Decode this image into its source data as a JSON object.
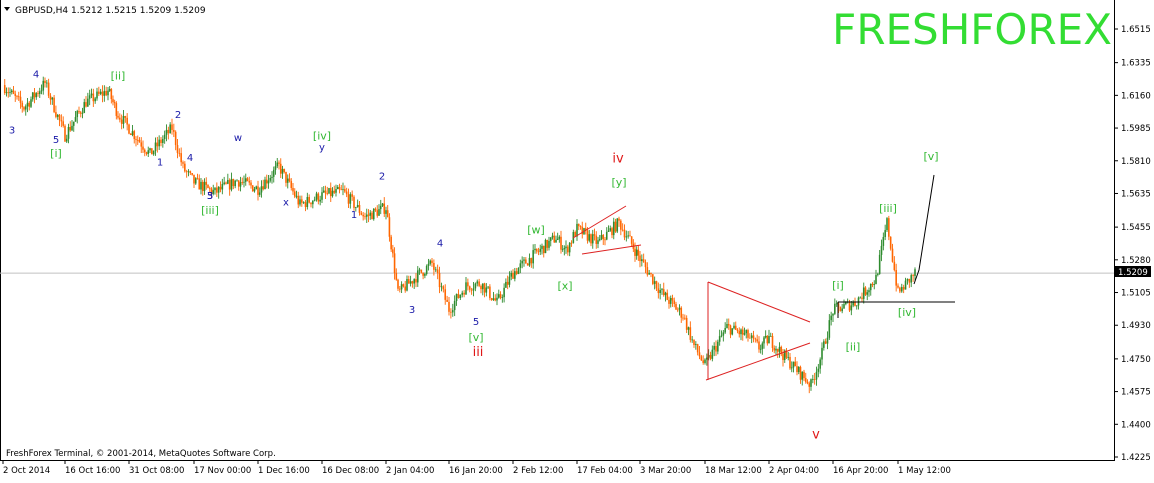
{
  "header": {
    "symbol_text": "GBPUSD,H4  1.5212 1.5215 1.5209 1.5209"
  },
  "watermark": {
    "text": "FRESHFOREX",
    "color": "#33dd33"
  },
  "footer": {
    "copyright": "FreshForex Terminal, © 2001-2014, MetaQuotes Software Corp."
  },
  "colors": {
    "candle_up": "#2e8b2e",
    "candle_down": "#ff6600",
    "trendline_red": "#dd2222",
    "projection_black": "#000000",
    "wave_blue": "#1a1aa8",
    "wave_green": "#33b833",
    "wave_red": "#e01818"
  },
  "chart_data": {
    "type": "line",
    "title": "GBPUSD,H4",
    "ohlc_header": {
      "open": 1.5212,
      "high": 1.5215,
      "low": 1.5209,
      "close": 1.5209
    },
    "current_price": "1.5209",
    "ylim": [
      1.4225,
      1.6615
    ],
    "y_ticks": [
      "1.6515",
      "1.6335",
      "1.6160",
      "1.5985",
      "1.5810",
      "1.5635",
      "1.5455",
      "1.5280",
      "1.5105",
      "1.4930",
      "1.4750",
      "1.4575",
      "1.4400",
      "1.4225"
    ],
    "x_ticks": [
      "2 Oct 2014",
      "16 Oct 16:00",
      "31 Oct 08:00",
      "17 Nov 00:00",
      "1 Dec 16:00",
      "16 Dec 08:00",
      "2 Jan 04:00",
      "16 Jan 20:00",
      "2 Feb 12:00",
      "17 Feb 04:00",
      "3 Mar 20:00",
      "18 Mar 12:00",
      "2 Apr 04:00",
      "16 Apr 20:00",
      "1 May 12:00"
    ],
    "grid": false,
    "series": [
      {
        "x": [
          "2 Oct 2014",
          "8 Oct",
          "12 Oct",
          "16 Oct 16:00",
          "20 Oct",
          "24 Oct",
          "28 Oct",
          "31 Oct 08:00",
          "4 Nov",
          "8 Nov",
          "11 Nov",
          "17 Nov 00:00",
          "21 Nov",
          "25 Nov",
          "1 Dec 16:00",
          "5 Dec",
          "10 Dec",
          "16 Dec 08:00",
          "20 Dec",
          "25 Dec",
          "2 Jan 04:00",
          "5 Jan",
          "9 Jan",
          "13 Jan",
          "16 Jan 20:00",
          "20 Jan",
          "26 Jan",
          "30 Jan",
          "2 Feb 12:00",
          "6 Feb",
          "10 Feb",
          "13 Feb",
          "17 Feb 04:00",
          "20 Feb",
          "24 Feb",
          "27 Feb",
          "3 Mar 20:00",
          "7 Mar",
          "11 Mar",
          "14 Mar",
          "18 Mar 12:00",
          "22 Mar",
          "26 Mar",
          "30 Mar",
          "2 Apr 04:00",
          "6 Apr",
          "10 Apr",
          "13 Apr",
          "16 Apr 20:00",
          "20 Apr",
          "24 Apr",
          "28 Apr",
          "1 May 12:00",
          "4 May"
        ],
        "values": [
          1.6215,
          1.6095,
          1.6225,
          1.5945,
          1.6125,
          1.6185,
          1.606,
          1.5985,
          1.5845,
          1.5985,
          1.577,
          1.5695,
          1.564,
          1.5705,
          1.566,
          1.578,
          1.5575,
          1.5625,
          1.5645,
          1.551,
          1.556,
          1.51,
          1.519,
          1.526,
          1.5015,
          1.514,
          1.5155,
          1.505,
          1.521,
          1.531,
          1.54,
          1.533,
          1.5445,
          1.537,
          1.548,
          1.538,
          1.5285,
          1.51,
          1.4985,
          1.482,
          1.4715,
          1.492,
          1.487,
          1.481,
          1.486,
          1.473,
          1.461,
          1.478,
          1.501,
          1.505,
          1.518,
          1.548,
          1.51,
          1.5209
        ]
      }
    ],
    "annotations": {
      "wave_labels": [
        {
          "text": "3",
          "x": "2 Oct 2014",
          "y": 1.5955,
          "level": "minor"
        },
        {
          "text": "4",
          "x": "8 Oct",
          "y": 1.6255,
          "level": "minor"
        },
        {
          "text": "5",
          "x": "12 Oct",
          "y": 1.5905,
          "level": "minor"
        },
        {
          "text": "[i]",
          "x": "12 Oct",
          "y": 1.583,
          "level": "minute"
        },
        {
          "text": "[ii]",
          "x": "20 Oct",
          "y": 1.6245,
          "level": "minute"
        },
        {
          "text": "1",
          "x": "28 Oct",
          "y": 1.5785,
          "level": "minor"
        },
        {
          "text": "2",
          "x": "31 Oct 08:00",
          "y": 1.604,
          "level": "minor"
        },
        {
          "text": "4",
          "x": "4 Nov",
          "y": 1.581,
          "level": "minor"
        },
        {
          "text": "3",
          "x": "4 Nov",
          "y": 1.5605,
          "level": "minor"
        },
        {
          "text": "5",
          "x": "8 Nov",
          "y": 1.5605,
          "level": "minor"
        },
        {
          "text": "[iii]",
          "x": "8 Nov",
          "y": 1.5525,
          "level": "minute"
        },
        {
          "text": "w",
          "x": "17 Nov 00:00",
          "y": 1.5915,
          "level": "minor"
        },
        {
          "text": "x",
          "x": "25 Nov",
          "y": 1.557,
          "level": "minor"
        },
        {
          "text": "[iv]",
          "x": "5 Dec",
          "y": 1.5925,
          "level": "minute"
        },
        {
          "text": "y",
          "x": "5 Dec",
          "y": 1.5865,
          "level": "minor"
        },
        {
          "text": "1",
          "x": "10 Dec",
          "y": 1.5505,
          "level": "minor"
        },
        {
          "text": "2",
          "x": "16 Dec 08:00",
          "y": 1.571,
          "level": "minor"
        },
        {
          "text": "4",
          "x": "20 Dec",
          "y": 1.535,
          "level": "minor"
        },
        {
          "text": "3",
          "x": "2 Jan 04:00",
          "y": 1.4995,
          "level": "minor"
        },
        {
          "text": "5",
          "x": "9 Jan",
          "y": 1.493,
          "level": "minor"
        },
        {
          "text": "[v]",
          "x": "9 Jan",
          "y": 1.4845,
          "level": "minute"
        },
        {
          "text": "iii",
          "x": "9 Jan",
          "y": 1.4765,
          "level": "minuette"
        },
        {
          "text": "[w]",
          "x": "2 Feb 12:00",
          "y": 1.542,
          "level": "minute"
        },
        {
          "text": "[x]",
          "x": "2 Feb 12:00",
          "y": 1.512,
          "level": "minute"
        },
        {
          "text": "iv",
          "x": "13 Feb",
          "y": 1.58,
          "level": "minuette"
        },
        {
          "text": "[y]",
          "x": "13 Feb",
          "y": 1.5675,
          "level": "minute"
        },
        {
          "text": "v",
          "x": "30 Mar",
          "y": 1.4325,
          "level": "minuette"
        },
        {
          "text": "[i]",
          "x": "13 Apr",
          "y": 1.5125,
          "level": "minute"
        },
        {
          "text": "[ii]",
          "x": "16 Apr 20:00",
          "y": 1.4795,
          "level": "minute"
        },
        {
          "text": "[iii]",
          "x": "24 Apr",
          "y": 1.5535,
          "level": "minute"
        },
        {
          "text": "[iv]",
          "x": "28 Apr",
          "y": 1.498,
          "level": "minute"
        },
        {
          "text": "[v]",
          "x": "1 May 12:00",
          "y": 1.5815,
          "level": "minute"
        }
      ]
    }
  }
}
